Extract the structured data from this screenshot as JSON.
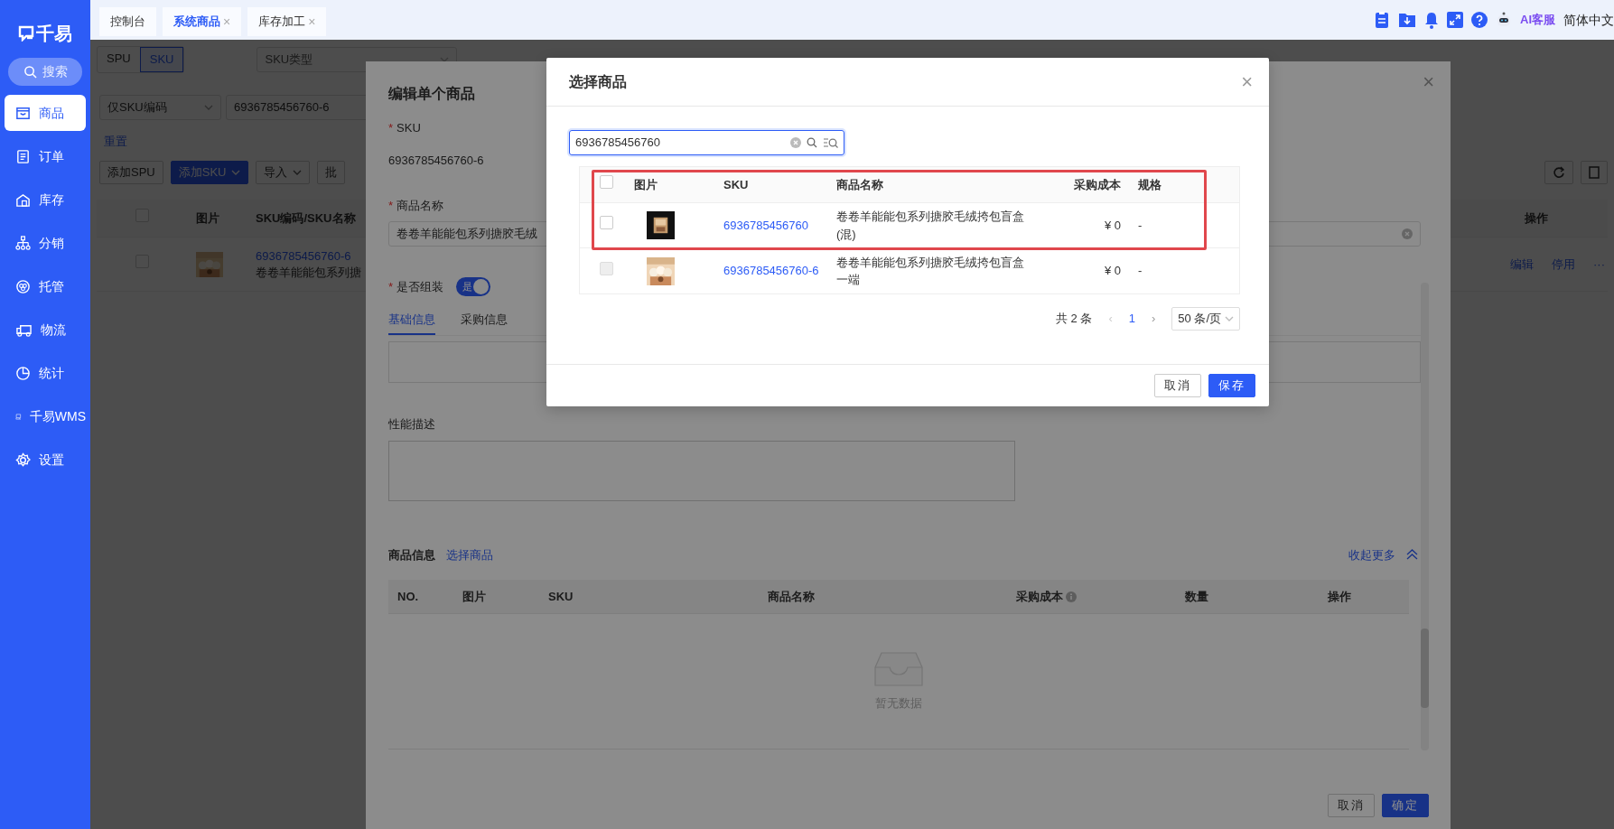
{
  "sidebar": {
    "logo": "千易",
    "search": "搜索",
    "items": [
      {
        "label": "商品",
        "selected": true
      },
      {
        "label": "订单",
        "selected": false
      },
      {
        "label": "库存",
        "selected": false
      },
      {
        "label": "分销",
        "selected": false
      },
      {
        "label": "托管",
        "selected": false
      },
      {
        "label": "物流",
        "selected": false
      },
      {
        "label": "统计",
        "selected": false
      },
      {
        "label": "千易WMS",
        "selected": false
      },
      {
        "label": "设置",
        "selected": false
      }
    ]
  },
  "tabs": [
    {
      "label": "控制台",
      "selected": false
    },
    {
      "label": "系统商品",
      "selected": true,
      "close": "×"
    },
    {
      "label": "库存加工",
      "selected": false,
      "close": "×"
    }
  ],
  "toolbar": {
    "assistant": "AI客服",
    "language": "简体中文"
  },
  "product_list": {
    "view_toggle": [
      {
        "label": "SPU",
        "selected": false
      },
      {
        "label": "SKU",
        "selected": true
      }
    ],
    "type_filter": {
      "placeholder": "SKU类型"
    },
    "search_mode": "仅SKU编码",
    "search_value": "6936785456760-6",
    "reset": "重置",
    "actions": [
      {
        "label": "添加SPU",
        "kind": "default",
        "dropdown": false
      },
      {
        "label": "添加SKU",
        "kind": "primary",
        "dropdown": true
      },
      {
        "label": "导入",
        "kind": "default",
        "dropdown": true
      },
      {
        "label": "批",
        "kind": "default",
        "dropdown": false
      }
    ],
    "all_checked": false,
    "columns": {
      "image": "图片",
      "sku": "SKU编码/SKU名称",
      "actions": "操作"
    },
    "rows": [
      {
        "checked": false,
        "sku": "6936785456760-6",
        "name": "卷卷羊能能包系列搪",
        "actions": [
          "编辑",
          "停用",
          "···"
        ]
      }
    ]
  },
  "edit_panel": {
    "title": "编辑单个商品",
    "close": "×",
    "fields": [
      {
        "kind": "text",
        "label": "SKU",
        "required_mark": "*",
        "value": "6936785456760-6"
      },
      {
        "kind": "input",
        "label": "商品名称",
        "required_mark": "*",
        "value": "卷卷羊能能包系列搪胶毛绒"
      },
      {
        "kind": "switch",
        "label": "是否组装",
        "required_mark": "*",
        "on": true,
        "switch_text": "是"
      }
    ],
    "tabs": [
      {
        "label": "基础信息",
        "selected": true
      },
      {
        "label": "采购信息",
        "selected": false
      }
    ],
    "description_label": "性能描述",
    "goods": {
      "title": "商品信息",
      "pick_link": "选择商品",
      "collapse_link": "收起更多",
      "columns": [
        {
          "label": "NO.",
          "info": false
        },
        {
          "label": "图片",
          "info": false
        },
        {
          "label": "SKU",
          "info": false
        },
        {
          "label": "商品名称",
          "info": false
        },
        {
          "label": "采购成本",
          "info": true
        },
        {
          "label": "数量",
          "info": false
        },
        {
          "label": "操作",
          "info": false
        }
      ],
      "empty_text": "暂无数据"
    },
    "buttons": [
      {
        "label": "取消",
        "kind": "default"
      },
      {
        "label": "确定",
        "kind": "primary"
      }
    ]
  },
  "select_dialog": {
    "title": "选择商品",
    "close": "×",
    "search_value": "6936785456760",
    "all_checked": false,
    "columns": [
      "图片",
      "SKU",
      "商品名称",
      "采购成本",
      "规格"
    ],
    "rows": [
      {
        "checked": false,
        "disabled": false,
        "highlighted": true,
        "sku": "6936785456760",
        "name": "卷卷羊能能包系列搪胶毛绒挎包盲盒(混)",
        "cost": "¥ 0",
        "spec": "-"
      },
      {
        "checked": false,
        "disabled": true,
        "highlighted": false,
        "sku": "6936785456760-6",
        "name": "卷卷羊能能包系列搪胶毛绒挎包盲盒一端",
        "cost": "¥ 0",
        "spec": "-"
      }
    ],
    "total": "共 2 条",
    "prev": "‹",
    "pages": [
      {
        "label": "1",
        "selected": true
      }
    ],
    "next": "›",
    "page_size": "50 条/页",
    "buttons": [
      {
        "label": "取消",
        "kind": "default"
      },
      {
        "label": "保存",
        "kind": "primary"
      }
    ]
  }
}
